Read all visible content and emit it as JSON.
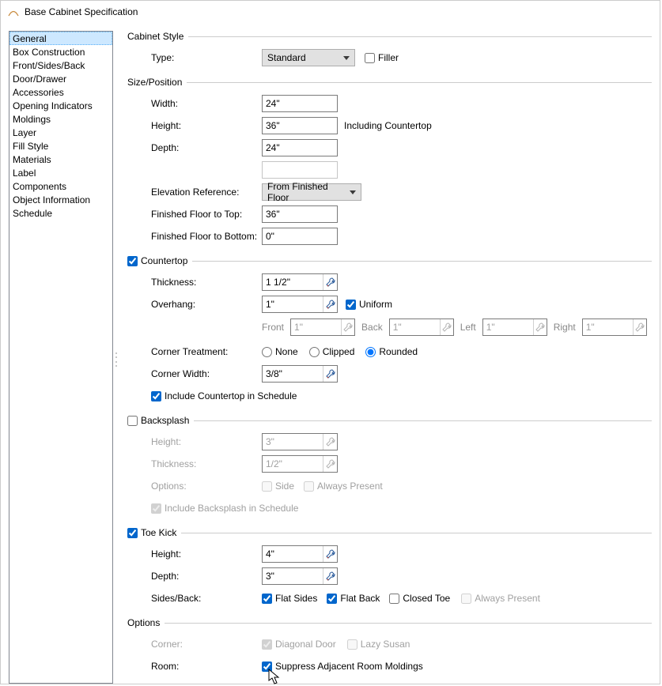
{
  "window": {
    "title": "Base Cabinet Specification"
  },
  "sidebar": {
    "items": [
      {
        "label": "General",
        "selected": true
      },
      {
        "label": "Box Construction"
      },
      {
        "label": "Front/Sides/Back"
      },
      {
        "label": "Door/Drawer"
      },
      {
        "label": "Accessories"
      },
      {
        "label": "Opening Indicators"
      },
      {
        "label": "Moldings"
      },
      {
        "label": "Layer"
      },
      {
        "label": "Fill Style"
      },
      {
        "label": "Materials"
      },
      {
        "label": "Label"
      },
      {
        "label": "Components"
      },
      {
        "label": "Object Information"
      },
      {
        "label": "Schedule"
      }
    ]
  },
  "cabinet_style": {
    "legend": "Cabinet Style",
    "type_label": "Type:",
    "type_value": "Standard",
    "filler_label": "Filler",
    "filler_checked": false
  },
  "size_position": {
    "legend": "Size/Position",
    "width_label": "Width:",
    "width_value": "24\"",
    "height_label": "Height:",
    "height_value": "36\"",
    "height_after": "Including Countertop",
    "depth_label": "Depth:",
    "depth_value": "24\"",
    "elev_ref_label": "Elevation Reference:",
    "elev_ref_value": "From Finished Floor",
    "floor_top_label": "Finished Floor to Top:",
    "floor_top_value": "36\"",
    "floor_bottom_label": "Finished Floor to Bottom:",
    "floor_bottom_value": "0\""
  },
  "countertop": {
    "legend": "Countertop",
    "enabled": true,
    "thickness_label": "Thickness:",
    "thickness_value": "1 1/2\"",
    "overhang_label": "Overhang:",
    "overhang_value": "1\"",
    "uniform_label": "Uniform",
    "uniform_checked": true,
    "front_label": "Front",
    "front_value": "1\"",
    "back_label": "Back",
    "back_value": "1\"",
    "left_label": "Left",
    "left_value": "1\"",
    "right_label": "Right",
    "right_value": "1\"",
    "corner_treatment_label": "Corner Treatment:",
    "ct_none": "None",
    "ct_clipped": "Clipped",
    "ct_rounded": "Rounded",
    "ct_selected": "Rounded",
    "corner_width_label": "Corner Width:",
    "corner_width_value": "3/8\"",
    "include_schedule_label": "Include Countertop in Schedule",
    "include_schedule_checked": true
  },
  "backsplash": {
    "legend": "Backsplash",
    "enabled": false,
    "height_label": "Height:",
    "height_value": "3\"",
    "thickness_label": "Thickness:",
    "thickness_value": "1/2\"",
    "options_label": "Options:",
    "side_label": "Side",
    "side_checked": false,
    "always_present_label": "Always Present",
    "always_present_checked": false,
    "include_schedule_label": "Include Backsplash in Schedule",
    "include_schedule_checked": true
  },
  "toe_kick": {
    "legend": "Toe Kick",
    "enabled": true,
    "height_label": "Height:",
    "height_value": "4\"",
    "depth_label": "Depth:",
    "depth_value": "3\"",
    "sides_back_label": "Sides/Back:",
    "flat_sides_label": "Flat Sides",
    "flat_sides_checked": true,
    "flat_back_label": "Flat Back",
    "flat_back_checked": true,
    "closed_toe_label": "Closed Toe",
    "closed_toe_checked": false,
    "always_present_label": "Always Present",
    "always_present_checked": false
  },
  "options": {
    "legend": "Options",
    "corner_label": "Corner:",
    "diagonal_label": "Diagonal Door",
    "diagonal_checked": true,
    "lazy_label": "Lazy Susan",
    "lazy_checked": false,
    "room_label": "Room:",
    "suppress_label": "Suppress Adjacent Room Moldings",
    "suppress_checked": true
  }
}
